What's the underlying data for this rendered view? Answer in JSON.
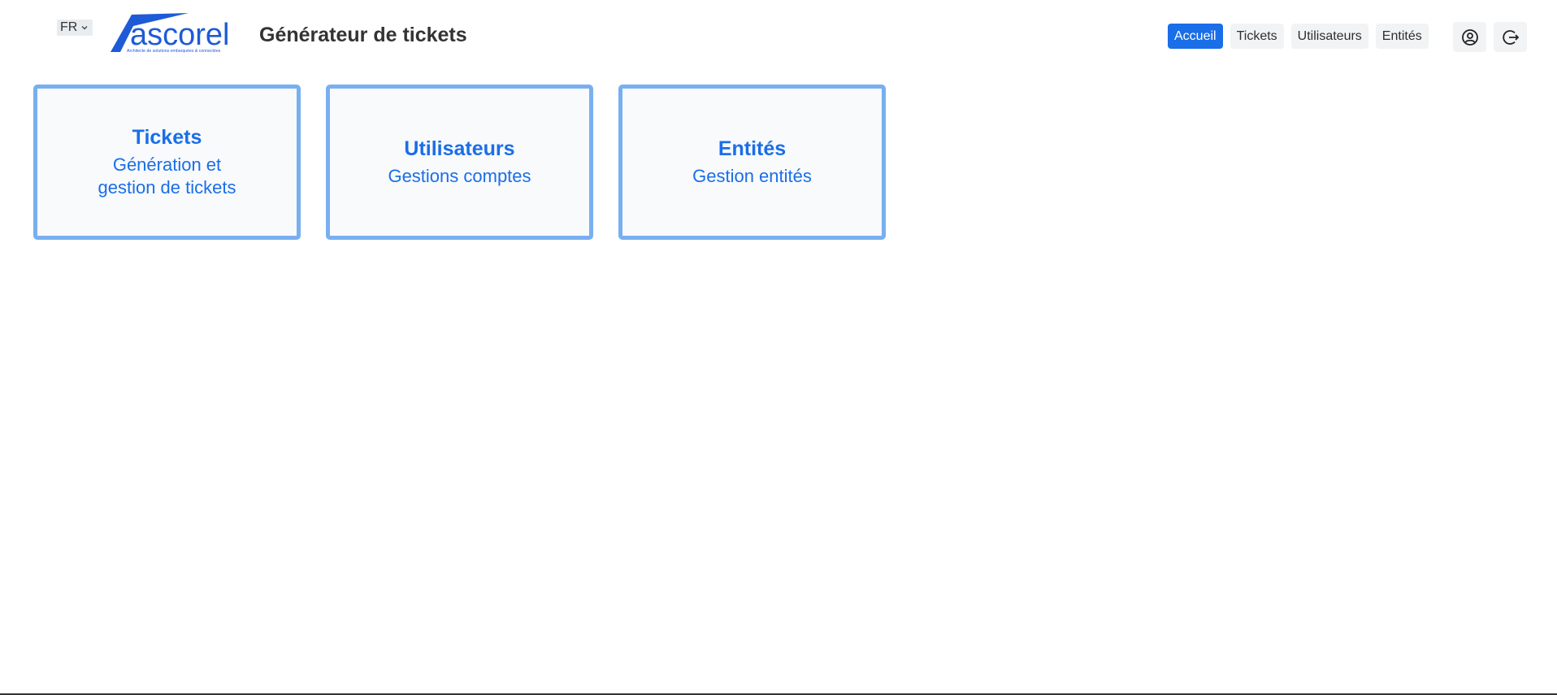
{
  "header": {
    "language": "FR",
    "logo_text": "ascorel",
    "logo_tagline": "Architecte de solutions embarquées & connectées",
    "title": "Générateur de tickets"
  },
  "nav": {
    "items": [
      {
        "label": "Accueil",
        "active": true
      },
      {
        "label": "Tickets",
        "active": false
      },
      {
        "label": "Utilisateurs",
        "active": false
      },
      {
        "label": "Entités",
        "active": false
      }
    ],
    "account_icon": "user-circle-icon",
    "logout_icon": "logout-icon"
  },
  "cards": [
    {
      "title": "Tickets",
      "subtitle_line1": "Génération et",
      "subtitle_line2": "gestion de tickets"
    },
    {
      "title": "Utilisateurs",
      "subtitle_line1": "Gestions comptes"
    },
    {
      "title": "Entités",
      "subtitle_line1": "Gestion entités"
    }
  ],
  "colors": {
    "accent": "#1a6ee8",
    "card_border": "#78aff0",
    "logo_blue": "#1e5bd6"
  }
}
